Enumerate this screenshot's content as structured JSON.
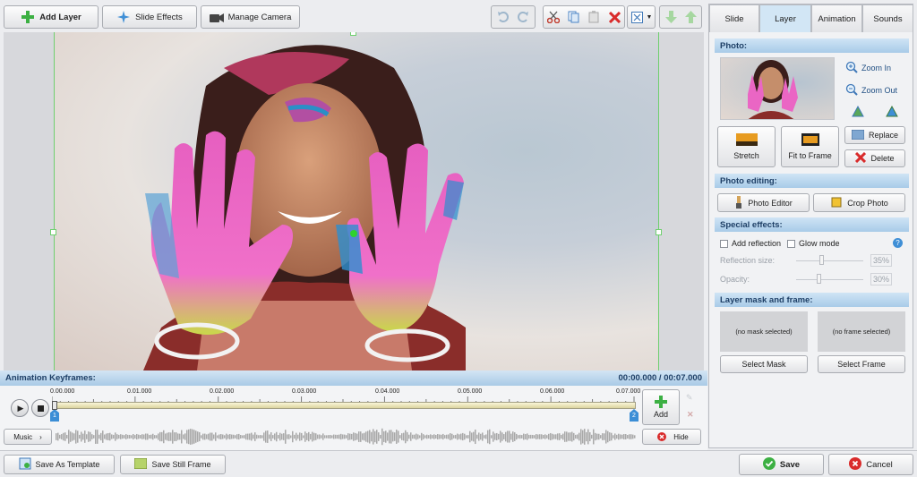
{
  "toolbar": {
    "add_layer": "Add Layer",
    "slide_effects": "Slide Effects",
    "manage_camera": "Manage Camera",
    "icons": [
      "undo-icon",
      "redo-icon",
      "cut-icon",
      "copy-icon",
      "paste-icon",
      "delete-icon",
      "zoom-fit-icon",
      "move-down-icon",
      "move-up-icon"
    ]
  },
  "tabs": [
    "Slide",
    "Layer",
    "Animation",
    "Sounds"
  ],
  "active_tab": "Layer",
  "photo_section": {
    "title": "Photo:",
    "zoom_in": "Zoom In",
    "zoom_out": "Zoom Out",
    "stretch": "Stretch",
    "fit_to_frame": "Fit to Frame",
    "replace": "Replace",
    "delete": "Delete"
  },
  "photo_editing": {
    "title": "Photo editing:",
    "photo_editor": "Photo Editor",
    "crop_photo": "Crop Photo"
  },
  "special_effects": {
    "title": "Special effects:",
    "add_reflection": "Add reflection",
    "glow_mode": "Glow mode",
    "reflection_size_label": "Reflection size:",
    "reflection_size_value": "35%",
    "opacity_label": "Opacity:",
    "opacity_value": "30%"
  },
  "layer_mask": {
    "title": "Layer mask and frame:",
    "no_mask": "(no mask selected)",
    "no_frame": "(no frame selected)",
    "select_mask": "Select Mask",
    "select_frame": "Select Frame"
  },
  "keyframes": {
    "title": "Animation Keyframes:",
    "time": "00:00.000 / 00:07.000",
    "ticks": [
      "0.00.000",
      "0.01.000",
      "0.02.000",
      "0.03.000",
      "0.04.000",
      "0.05.000",
      "0.06.000",
      "0.07.000"
    ],
    "keyframe_1": "1",
    "keyframe_2": "2",
    "music": "Music",
    "add": "Add",
    "hide": "Hide"
  },
  "footer": {
    "save_as_template": "Save As Template",
    "save_still_frame": "Save Still Frame",
    "save": "Save",
    "cancel": "Cancel"
  },
  "colors": {
    "accent": "#a9cae6",
    "header_text": "#1e3f66",
    "add_green": "#3cb043",
    "delete_red": "#d92b2b",
    "frame_guide": "#6fcf6f"
  }
}
